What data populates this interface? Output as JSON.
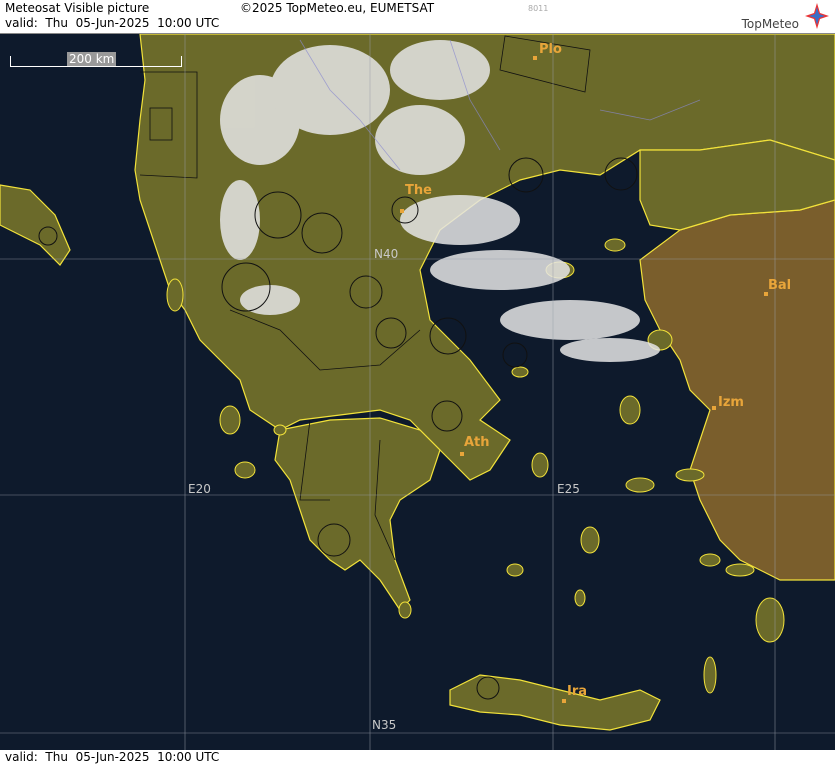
{
  "header": {
    "title": "Meteosat Visible picture",
    "copyright": "©2025 TopMeteo.eu, EUMETSAT",
    "valid": "valid:  Thu  05-Jun-2025  10:00 UTC",
    "code": "8011",
    "logo": "TopMeteo"
  },
  "footer": {
    "valid": "valid:  Thu  05-Jun-2025  10:00 UTC"
  },
  "scale": {
    "label": "200 km"
  },
  "cities": [
    {
      "abbr": "Plo"
    },
    {
      "abbr": "The"
    },
    {
      "abbr": "Bal"
    },
    {
      "abbr": "Izm"
    },
    {
      "abbr": "Ath"
    },
    {
      "abbr": "Ira"
    }
  ],
  "grid_labels": [
    "N40",
    "E20",
    "E25",
    "N35"
  ],
  "colors": {
    "land": "#6b6a2a",
    "sea": "#0e1a2c",
    "coast": "#f2e23a",
    "cloud": "#e6e6e6",
    "city": "#e8a53a"
  }
}
